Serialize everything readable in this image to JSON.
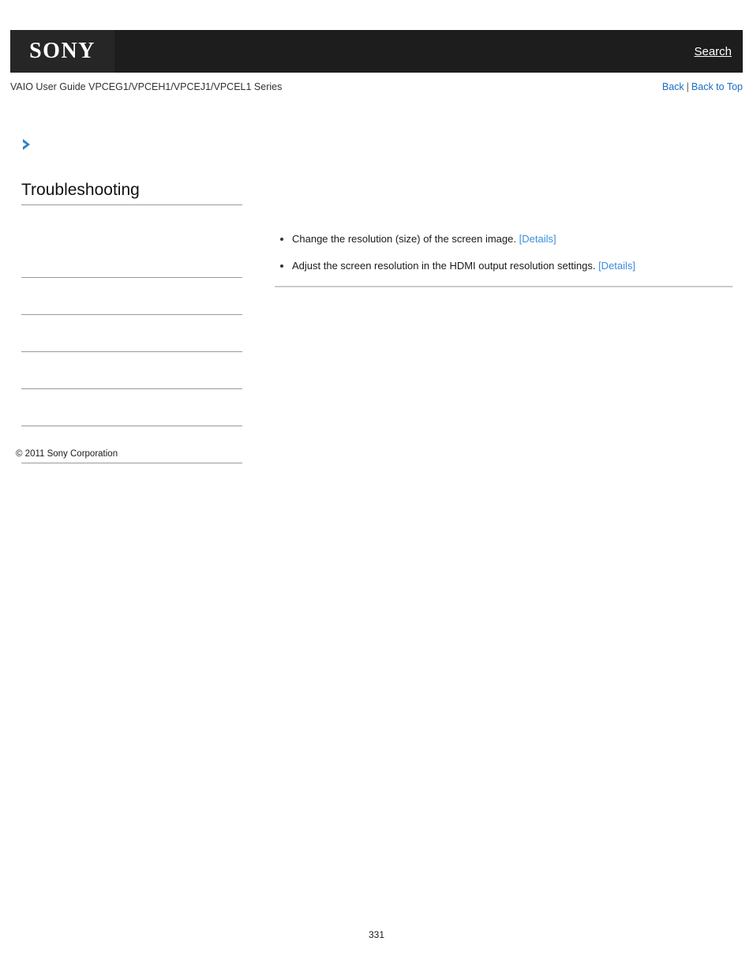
{
  "header": {
    "logo_text": "SONY",
    "logo_icon": "sony-logo",
    "search_label": "Search",
    "bar_color": "#1d1d1d",
    "logo_box_color": "#262626"
  },
  "subheader": {
    "guide_title": "VAIO User Guide VPCEG1/VPCEH1/VPCEJ1/VPCEL1 Series",
    "back_label": "Back",
    "separator": "|",
    "back_to_top_label": "Back to Top",
    "link_color": "#1a6fc4"
  },
  "chevron": {
    "icon": "chevron-right-icon",
    "color": "#2f83c5"
  },
  "sidebar": {
    "title": "Troubleshooting",
    "items": [
      {
        "label": ""
      },
      {
        "label": ""
      },
      {
        "label": ""
      },
      {
        "label": ""
      },
      {
        "label": ""
      },
      {
        "label": ""
      }
    ]
  },
  "content": {
    "bullets": [
      {
        "text": "Change the resolution (size) of the screen image.",
        "link_label": "[Details]"
      },
      {
        "text": "Adjust the screen resolution in the HDMI output resolution settings.",
        "link_label": "[Details]"
      }
    ],
    "link_color": "#3a8ddb"
  },
  "footer": {
    "copyright": "© 2011 Sony Corporation",
    "page_number": "331"
  }
}
